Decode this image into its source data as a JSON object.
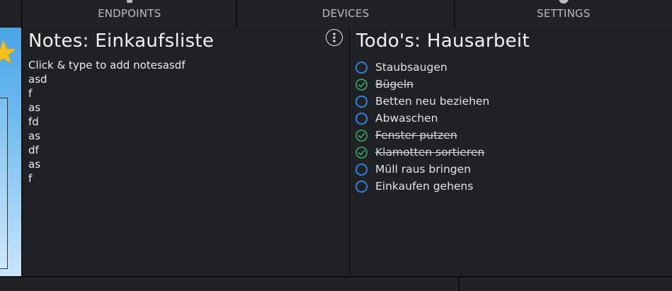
{
  "tabs": [
    {
      "label": "ENDPOINTS",
      "icon": "endpoints-icon"
    },
    {
      "label": "DEVICES",
      "icon": "devices-icon"
    },
    {
      "label": "SETTINGS",
      "icon": "gear-icon"
    }
  ],
  "notes": {
    "title": "Notes: Einkaufsliste",
    "menu_icon": "more-vertical-icon",
    "lines": [
      "Click & type to add notesasdf",
      "asd",
      "f",
      "as",
      "fd",
      "as",
      "df",
      "as",
      "f"
    ]
  },
  "todos": {
    "title": "Todo's: Hausarbeit",
    "items": [
      {
        "label": "Staubsaugen",
        "done": false
      },
      {
        "label": "Bügeln",
        "done": true
      },
      {
        "label": "Betten neu beziehen",
        "done": false
      },
      {
        "label": "Abwaschen",
        "done": false
      },
      {
        "label": "Fenster putzen",
        "done": true
      },
      {
        "label": "Klamotten sortieren",
        "done": true
      },
      {
        "label": "Müll raus bringen",
        "done": false
      },
      {
        "label": "Einkaufen gehens",
        "done": false
      }
    ]
  },
  "colors": {
    "background": "#1f2124",
    "open_circle": "#2f7fe0",
    "done_check": "#3aa865"
  }
}
